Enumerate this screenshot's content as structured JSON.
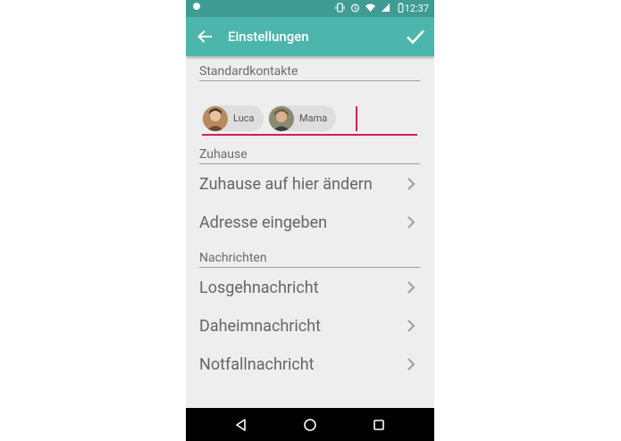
{
  "status_bar": {
    "time": "12:37"
  },
  "app_bar": {
    "title": "Einstellungen"
  },
  "sections": {
    "contacts": "Standardkontakte",
    "home": "Zuhause",
    "messages": "Nachrichten"
  },
  "contacts": [
    {
      "name": "Luca"
    },
    {
      "name": "Mama"
    }
  ],
  "home_items": [
    {
      "label": "Zuhause auf hier ändern"
    },
    {
      "label": "Adresse eingeben"
    }
  ],
  "message_items": [
    {
      "label": "Losgehnachricht"
    },
    {
      "label": "Daheimnachricht"
    },
    {
      "label": "Notfallnachricht"
    }
  ],
  "colors": {
    "primary": "#4db6ac",
    "primary_dark": "#3f9c92",
    "accent": "#d81b60",
    "background": "#eeeeee"
  }
}
